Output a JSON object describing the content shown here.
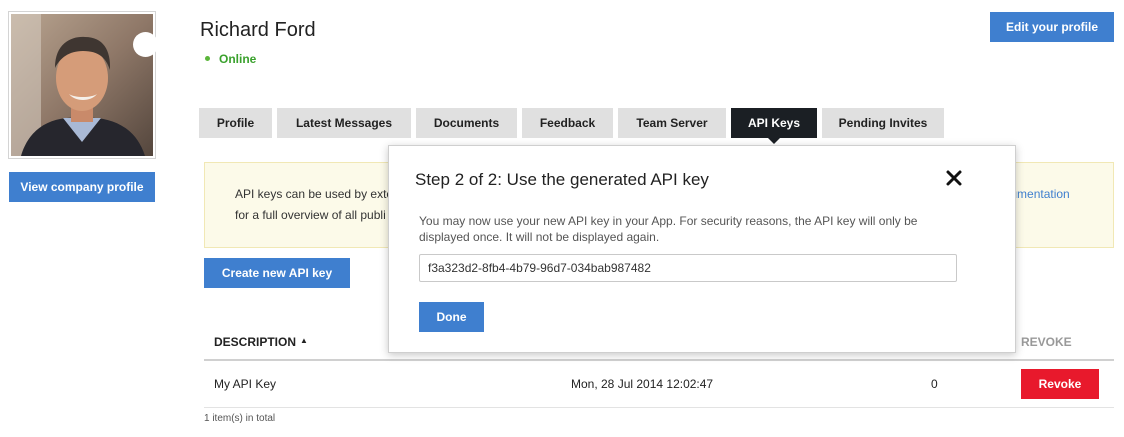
{
  "profile": {
    "name": "Richard Ford",
    "status": "Online",
    "view_company_label": "View company profile",
    "edit_profile_label": "Edit your profile"
  },
  "tabs": [
    {
      "label": "Profile",
      "active": false
    },
    {
      "label": "Latest Messages",
      "active": false
    },
    {
      "label": "Documents",
      "active": false
    },
    {
      "label": "Feedback",
      "active": false
    },
    {
      "label": "Team Server",
      "active": false
    },
    {
      "label": "API Keys",
      "active": true
    },
    {
      "label": "Pending Invites",
      "active": false
    }
  ],
  "info": {
    "line1": "API keys can be used by exte",
    "line2": "for a full overview of all publi",
    "link": "documentation"
  },
  "create_key_label": "Create new API key",
  "table": {
    "headers": {
      "description": "DESCRIPTION",
      "revoke": "REVOKE"
    },
    "rows": [
      {
        "description": "My API Key",
        "created": "Mon, 28 Jul 2014 12:02:47",
        "count": "0",
        "action": "Revoke"
      }
    ],
    "total": "1 item(s) in total"
  },
  "modal": {
    "title": "Step 2 of 2: Use the generated API key",
    "message": "You may now use your new API key in your App. For security reasons, the API key will only be displayed once. It will not be displayed again.",
    "api_key": "f3a323d2-8fb4-4b79-96d7-034bab987482",
    "done_label": "Done"
  },
  "colors": {
    "primary": "#3f7fcf",
    "danger": "#e8192c",
    "online": "#3aa12d",
    "active_tab": "#1b1f24"
  },
  "icons": {
    "close": "close-icon",
    "sort": "sort-ascending-icon",
    "status": "online-status-icon"
  }
}
